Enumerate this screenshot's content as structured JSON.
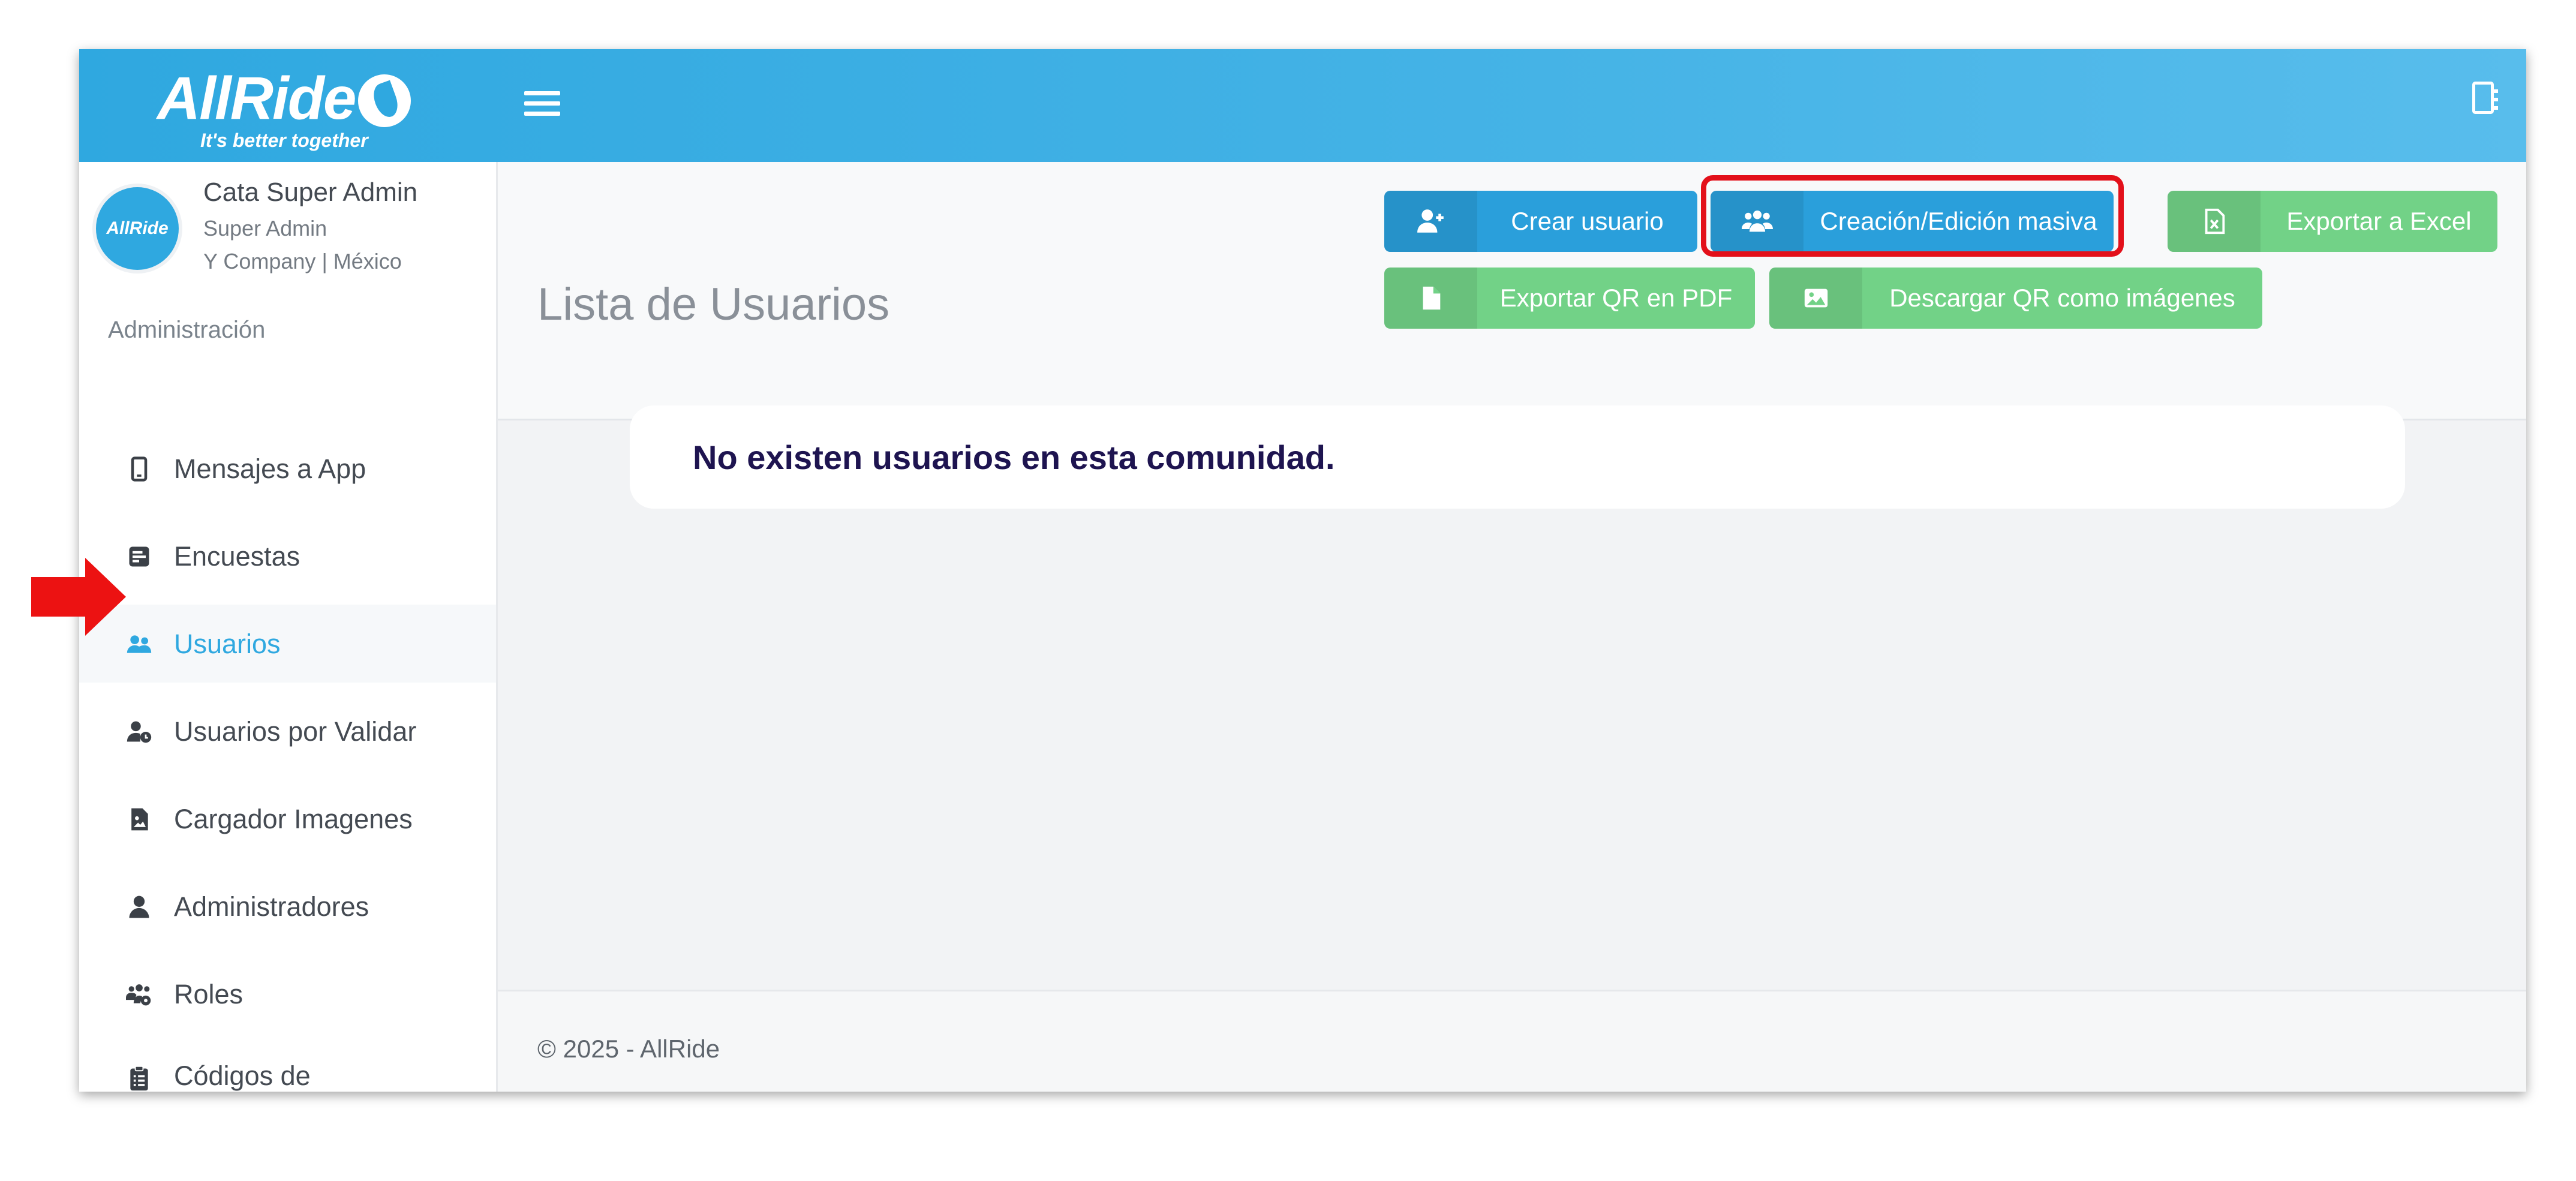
{
  "header": {
    "logo_text": "AllRide",
    "logo_tagline": "It's better together"
  },
  "user": {
    "avatar_text": "AllRide",
    "name": "Cata Super Admin",
    "role": "Super Admin",
    "company": "Y Company | México"
  },
  "sidebar": {
    "section_title": "Administración",
    "items": [
      {
        "label": "Mensajes a App",
        "icon": "mobile-phone-icon"
      },
      {
        "label": "Encuestas",
        "icon": "poll-icon"
      },
      {
        "label": "Usuarios",
        "icon": "users-icon",
        "active": true
      },
      {
        "label": "Usuarios por Validar",
        "icon": "user-clock-icon"
      },
      {
        "label": "Cargador Imagenes",
        "icon": "image-file-icon"
      },
      {
        "label": "Administradores",
        "icon": "user-icon"
      },
      {
        "label": "Roles",
        "icon": "users-cog-icon"
      },
      {
        "label": "Códigos de enrolamiento",
        "icon": "clipboard-list-icon"
      }
    ]
  },
  "main": {
    "page_title": "Lista de Usuarios",
    "buttons": {
      "create_user": "Crear usuario",
      "bulk_edit": "Creación/Edición masiva",
      "export_excel": "Exportar a Excel",
      "export_qr_pdf": "Exportar QR en PDF",
      "download_qr_images": "Descargar QR como imágenes"
    },
    "empty_message": "No existen usuarios en esta comunidad."
  },
  "footer": {
    "copyright": "© 2025 - AllRide"
  },
  "colors": {
    "header_blue": "#2fa8e0",
    "button_blue": "#2a9fdb",
    "button_green": "#72d287",
    "highlight_red": "#e3101a",
    "arrow_red": "#ec1212"
  }
}
